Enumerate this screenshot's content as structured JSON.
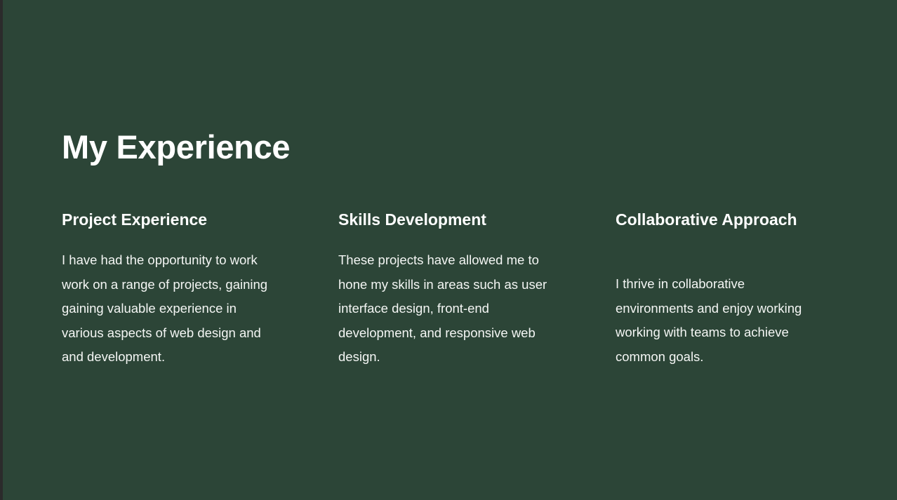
{
  "slide": {
    "title": "My Experience",
    "columns": [
      {
        "heading": "Project Experience",
        "body": "I have had the opportunity to work\nwork on a range of projects, gaining\ngaining valuable experience in\nvarious aspects of web design and\nand development."
      },
      {
        "heading": "Skills Development",
        "body": "These projects have allowed me to\nhone my skills in areas such as user\ninterface design, front-end\ndevelopment, and responsive web\ndesign."
      },
      {
        "heading": "Collaborative Approach",
        "body": "I thrive in collaborative\nenvironments and enjoy working\nworking with teams to achieve\ncommon goals."
      }
    ]
  },
  "colors": {
    "background": "#2c4537",
    "text": "#ffffff",
    "edge": "#2b2b2b"
  }
}
